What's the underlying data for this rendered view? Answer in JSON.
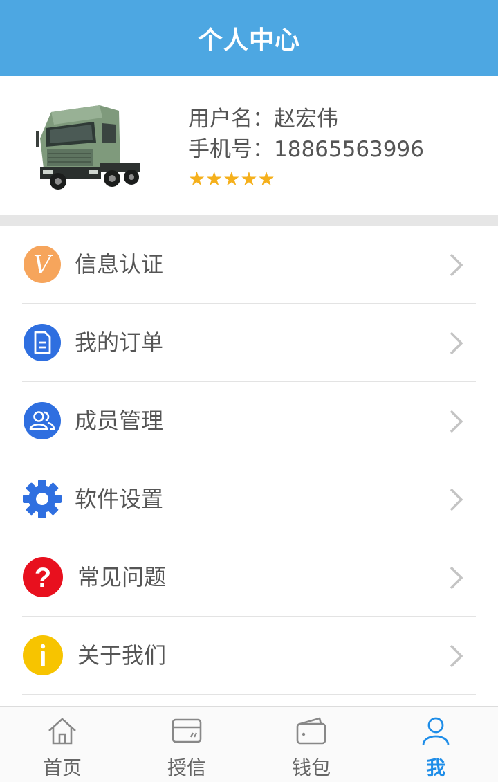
{
  "header": {
    "title": "个人中心"
  },
  "profile": {
    "username_label": "用户名：",
    "username": "赵宏伟",
    "phone_label": "手机号：",
    "phone": "18865563996",
    "rating": 5,
    "avatar_icon": "truck-avatar-icon"
  },
  "menu": [
    {
      "label": "信息认证",
      "icon": "verify-v-icon",
      "color": "#f6a55c"
    },
    {
      "label": "我的订单",
      "icon": "document-icon",
      "color": "#2f6fe0"
    },
    {
      "label": "成员管理",
      "icon": "members-icon",
      "color": "#2f6fe0"
    },
    {
      "label": "软件设置",
      "icon": "gear-icon",
      "color": "#2f6fe0"
    },
    {
      "label": "常见问题",
      "icon": "question-icon",
      "color": "#e8101e"
    },
    {
      "label": "关于我们",
      "icon": "info-icon",
      "color": "#f7c400"
    }
  ],
  "tabs": [
    {
      "label": "首页",
      "icon": "home-icon"
    },
    {
      "label": "授信",
      "icon": "credit-card-icon"
    },
    {
      "label": "钱包",
      "icon": "wallet-icon"
    },
    {
      "label": "我",
      "icon": "user-icon",
      "active": true
    }
  ],
  "colors": {
    "header": "#4da7e2",
    "active_tab": "#1e8de8",
    "star": "#f5b01c"
  }
}
